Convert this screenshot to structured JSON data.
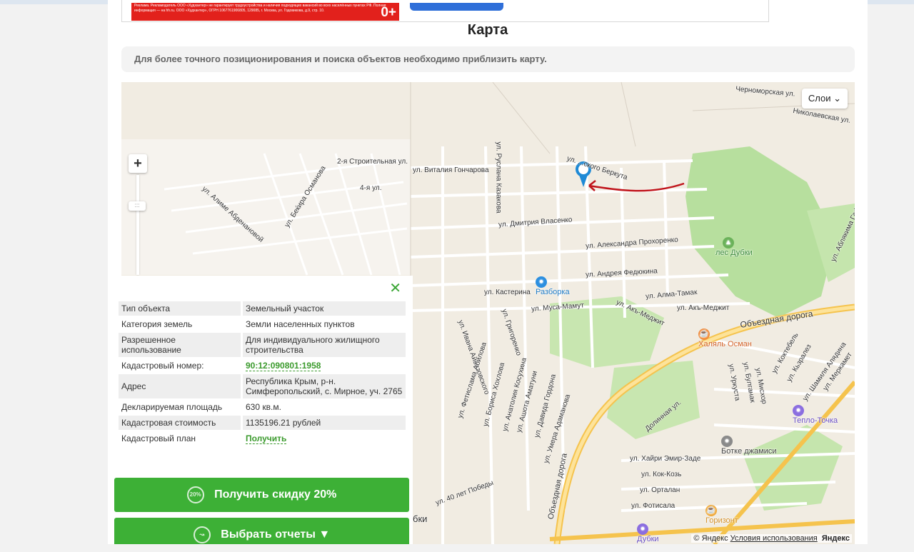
{
  "ad": {
    "text": "Реклама. Рекламодатель ООО «Худхантер» не гарантирует трудоустройства и наличия подходящих вакансий во всех населённых пунктах РФ. Полная информация — на hh.ru. ООО «Худхантер», ОГРН 1067761906805, 129085, г. Москва, ул. Годовикова, д.9, стр. 10.",
    "age": "0+"
  },
  "title": "Карта",
  "notice": "Для более точного позиционирования и поиска объектов необходимо приблизить карту.",
  "map": {
    "layers_button": "Слои",
    "zoom_plus": "+",
    "zoom_handle": ":::",
    "street_labels": [
      "Черноморская ул.",
      "Николаевская ул.",
      "2-я Строительная ул.",
      "4-я ул.",
      "ул. Беќира Османова",
      "ул. Алиме Абденановой",
      "ул. Виталия Гончарова",
      "ул. Руслана Казакова",
      "ул. ...ского Беркута",
      "ул. Дмитрия Власенко",
      "ул. Александра Прохоренко",
      "ул. Андрея Федюкина",
      "ул. Кастерина",
      "ул. Муса-Мамут",
      "ул. Алма-Тамак",
      "ул. Акъ-Меджит",
      "ул. Акъ-Меджит",
      "Объездная дорога",
      "Объездная дорога",
      "ул. Ивана Айвазовского",
      "ул. Григоренко",
      "ул. Фетислама Абилова",
      "ул. Бориса Хохлова",
      "ул. Анатолия Косухина",
      "ул. Ашота Аматуни",
      "ул. Давида Гордона",
      "ул. Умера Адаманова",
      "ул. 40 лет Победы",
      "Долинная ул.",
      "ул. Хайри Эмир-Заде",
      "ул. Кок-Козь",
      "ул. Орталан",
      "ул. Фотисала",
      "ул. Уркуста",
      "ул. Булганак",
      "ул. Мисхор",
      "ул. Коктебель",
      "ул. Кьзралез",
      "ул. Шамиля Алядина",
      "ул. Меркамет",
      "ул. Аблякима Гафара"
    ],
    "pois": {
      "forest": "лес Дубки",
      "razborka": "Разборка",
      "halal": "Халяль Осман",
      "teplo": "Тепло-Точка",
      "botke": "Ботке джамиси",
      "horizon": "Горизонт",
      "dubki": "Дубки",
      "bki": "бки"
    },
    "copyright": {
      "prefix": "© Яндекс",
      "terms": "Условия использования",
      "brand": "Яндекс"
    }
  },
  "info": {
    "close": "✕",
    "rows": [
      {
        "key": "Тип объекта",
        "value": "Земельный участок"
      },
      {
        "key": "Категория земель",
        "value": "Земли населенных пунктов"
      },
      {
        "key": "Разрешенное использование",
        "value": "Для индивидуального жилищного строительства"
      },
      {
        "key": "Кадастровый номер:",
        "value": "90:12:090801:1958"
      },
      {
        "key": "Адрес",
        "value": "Республика Крым, р-н. Симферопольский, с. Мирное, уч. 2765"
      },
      {
        "key": "Декларируемая площадь",
        "value": "630 кв.м."
      },
      {
        "key": "Кадастровая стоимость",
        "value": "1135196.21 рублей"
      },
      {
        "key": "Кадастровый план",
        "value": "Получить"
      }
    ]
  },
  "buttons": {
    "discount": "Получить скидку 20%",
    "discount_icon": "20%",
    "reports": "Выбрать отчеты ▼"
  },
  "colors": {
    "accent_green": "#3db036",
    "link_green": "#3a9a2c",
    "marker_blue": "#1e8ad6",
    "arrow_red": "#c0141b"
  }
}
